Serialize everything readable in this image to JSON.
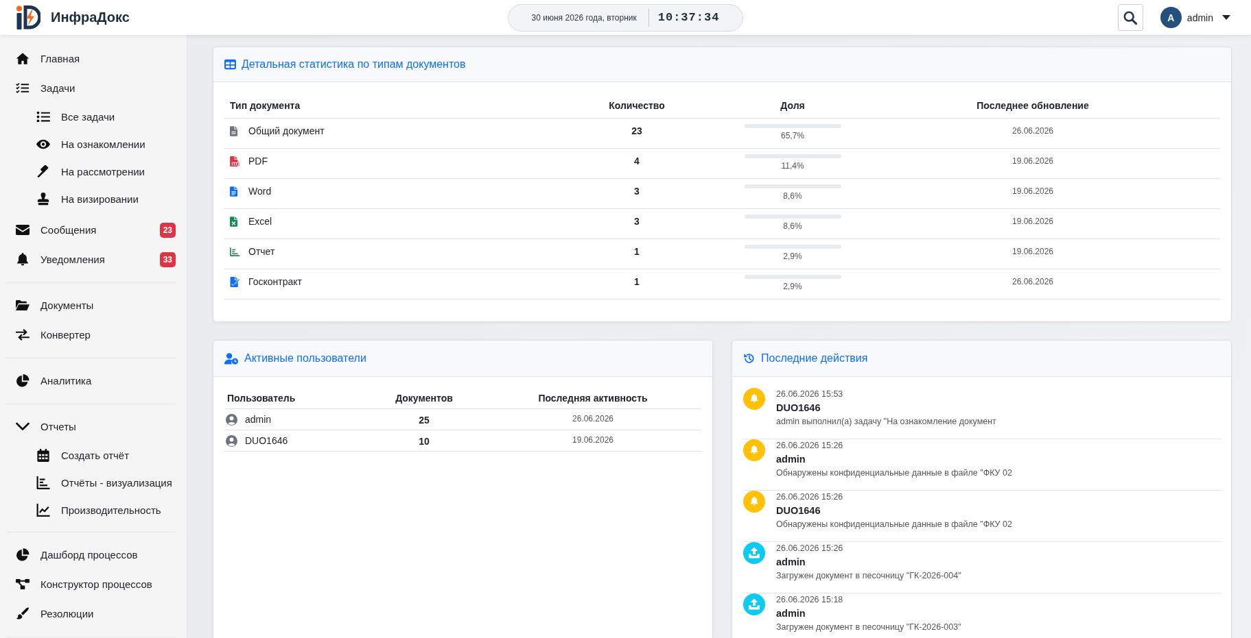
{
  "header": {
    "brand": "ИнфраДокс",
    "date": "30 июня 2026 года, вторник",
    "time": "10:37:34",
    "user": {
      "initial": "A",
      "name": "admin"
    }
  },
  "sidebar": {
    "groups": [
      {
        "items": [
          {
            "label": "Главная"
          },
          {
            "label": "Задачи",
            "children": [
              {
                "label": "Все задачи"
              },
              {
                "label": "На ознакомлении"
              },
              {
                "label": "На рассмотрении"
              },
              {
                "label": "На визировании"
              }
            ]
          },
          {
            "label": "Сообщения",
            "badge": "23"
          },
          {
            "label": "Уведомления",
            "badge": "33"
          }
        ]
      },
      {
        "items": [
          {
            "label": "Документы"
          },
          {
            "label": "Конвертер"
          }
        ]
      },
      {
        "items": [
          {
            "label": "Аналитика"
          }
        ]
      },
      {
        "items": [
          {
            "label": "Отчеты",
            "expanded": true,
            "children": [
              {
                "label": "Создать отчёт"
              },
              {
                "label": "Отчёты - визуализация"
              },
              {
                "label": "Производительность"
              }
            ]
          }
        ]
      },
      {
        "items": [
          {
            "label": "Дашборд процессов"
          },
          {
            "label": "Конструктор процессов"
          },
          {
            "label": "Резолюции"
          }
        ]
      }
    ]
  },
  "doc_stats": {
    "title": "Детальная статистика по типам документов",
    "columns": [
      "Тип документа",
      "Количество",
      "Доля",
      "Последнее обновление"
    ],
    "rows": [
      {
        "type": "Общий документ",
        "count": "23",
        "share": "65,7%",
        "updated": "26.06.2026"
      },
      {
        "type": "PDF",
        "count": "4",
        "share": "11,4%",
        "updated": "19.06.2026"
      },
      {
        "type": "Word",
        "count": "3",
        "share": "8,6%",
        "updated": "19.06.2026"
      },
      {
        "type": "Excel",
        "count": "3",
        "share": "8,6%",
        "updated": "19.06.2026"
      },
      {
        "type": "Отчет",
        "count": "1",
        "share": "2,9%",
        "updated": "19.06.2026"
      },
      {
        "type": "Госконтракт",
        "count": "1",
        "share": "2,9%",
        "updated": "26.06.2026"
      }
    ]
  },
  "active_users": {
    "title": "Активные пользователи",
    "columns": [
      "Пользователь",
      "Документов",
      "Последняя активность"
    ],
    "rows": [
      {
        "user": "admin",
        "documents": "25",
        "last_active": "26.06.2026"
      },
      {
        "user": "DUO1646",
        "documents": "10",
        "last_active": "19.06.2026"
      }
    ]
  },
  "recent_actions": {
    "title": "Последние действия",
    "items": [
      {
        "kind": "notification",
        "time": "26.06.2026 15:53",
        "user": "DUO1646",
        "text": "admin выполнил(а) задачу \"На ознакомление документ"
      },
      {
        "kind": "notification",
        "time": "26.06.2026 15:26",
        "user": "admin",
        "text": "Обнаружены конфиденциальные данные в файле \"ФКУ 02"
      },
      {
        "kind": "notification",
        "time": "26.06.2026 15:26",
        "user": "DUO1646",
        "text": "Обнаружены конфиденциальные данные в файле \"ФКУ 02"
      },
      {
        "kind": "upload",
        "time": "26.06.2026 15:26",
        "user": "admin",
        "text": "Загружен документ в песочницу \"ГК-2026-004\""
      },
      {
        "kind": "upload",
        "time": "26.06.2026 15:18",
        "user": "admin",
        "text": "Загружен документ в песочницу \"ГК-2026-003\""
      }
    ]
  }
}
